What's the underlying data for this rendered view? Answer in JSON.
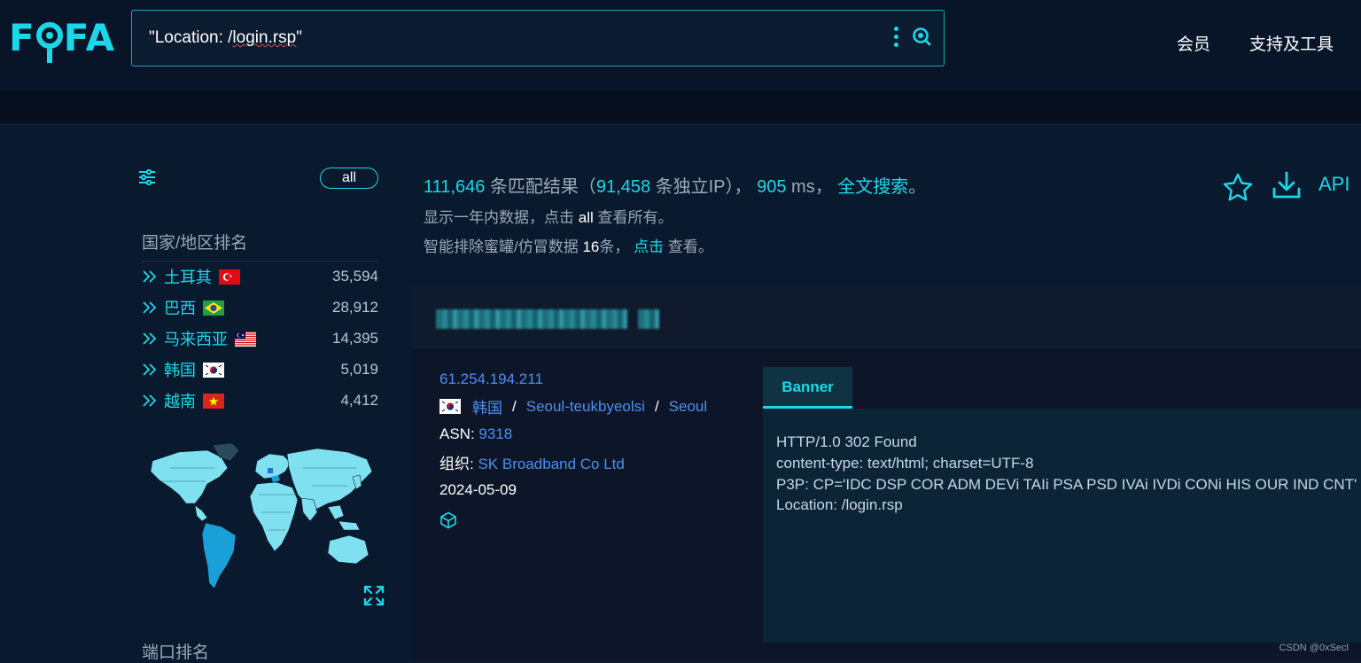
{
  "header": {
    "logo": "FOFA",
    "search_value": "\"Location: /login.rsp\"",
    "nav": [
      "会员",
      "支持及工具"
    ]
  },
  "sidebar": {
    "filter_label": "all",
    "country_title": "国家/地区排名",
    "countries": [
      {
        "name": "土耳其",
        "count": "35,594",
        "flag": "turkey-flag"
      },
      {
        "name": "巴西",
        "count": "28,912",
        "flag": "brazil-flag"
      },
      {
        "name": "马来西亚",
        "count": "14,395",
        "flag": "malaysia-flag"
      },
      {
        "name": "韩国",
        "count": "5,019",
        "flag": "korea-flag"
      },
      {
        "name": "越南",
        "count": "4,412",
        "flag": "vietnam-flag"
      }
    ],
    "port_title": "端口排名"
  },
  "stats": {
    "matches": "111,646",
    "matches_label": "条匹配结果（",
    "unique_ip": "91,458",
    "unique_ip_label": "条独立IP），",
    "time": "905",
    "time_unit": "ms，",
    "fulltext": "全文搜索",
    "fulltext_end": "。",
    "line2_a": "显示一年内数据，点击",
    "line2_all": "all",
    "line2_b": "查看所有。",
    "line3_a": "智能排除蜜罐/仿冒数据",
    "line3_num": "16",
    "line3_b": "条，",
    "line3_click": "点击",
    "line3_c": "查看。"
  },
  "actions": {
    "api": "API"
  },
  "result": {
    "ip": "61.254.194.211",
    "country": "韩国",
    "region": "Seoul-teukbyeolsi",
    "city": "Seoul",
    "asn_label": "ASN:",
    "asn": "9318",
    "org_label": "组织:",
    "org": "SK Broadband Co Ltd",
    "date": "2024-05-09",
    "banner_tab": "Banner",
    "banner_lines": [
      "HTTP/1.0 302 Found",
      "content-type: text/html; charset=UTF-8",
      "P3P: CP='IDC DSP COR ADM DEVi TAIi PSA PSD IVAi IVDi CONi HIS OUR IND CNT'",
      "Location: /login.rsp"
    ]
  },
  "watermark": "CSDN @0xSecl",
  "colors": {
    "accent": "#1ad8e8",
    "link": "#4d8ff0",
    "background": "#0a1a2e"
  }
}
